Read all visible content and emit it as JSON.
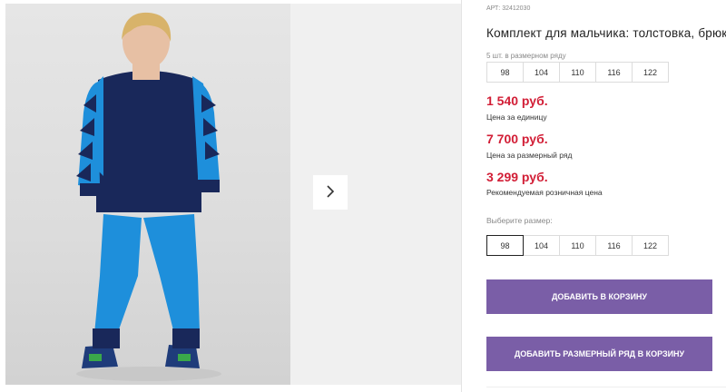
{
  "product": {
    "sku": "АРТ: 32412030",
    "title": "Комплект для мальчика: толстовка, брюки",
    "size_range_note": "5 шт. в размерном ряду",
    "size_range": [
      "98",
      "104",
      "110",
      "116",
      "122"
    ]
  },
  "prices": {
    "unit_price": "1 540 руб.",
    "unit_label": "Цена за единицу",
    "set_price": "7 700 руб.",
    "set_label": "Цена за размерный ряд",
    "retail_price": "3 299 руб.",
    "retail_label": "Рекомендуемая розничная цена"
  },
  "size_picker": {
    "label": "Выберите размер:",
    "options": [
      "98",
      "104",
      "110",
      "116",
      "122"
    ],
    "selected": "98"
  },
  "actions": {
    "add_to_cart": "Добавить в корзину",
    "add_set_to_cart": "Добавить размерный ряд в корзину"
  },
  "gallery": {
    "next_icon": "chevron-right-icon"
  },
  "colors": {
    "price": "#d21e36",
    "button": "#7a5ea7",
    "selected_border": "#222222"
  }
}
